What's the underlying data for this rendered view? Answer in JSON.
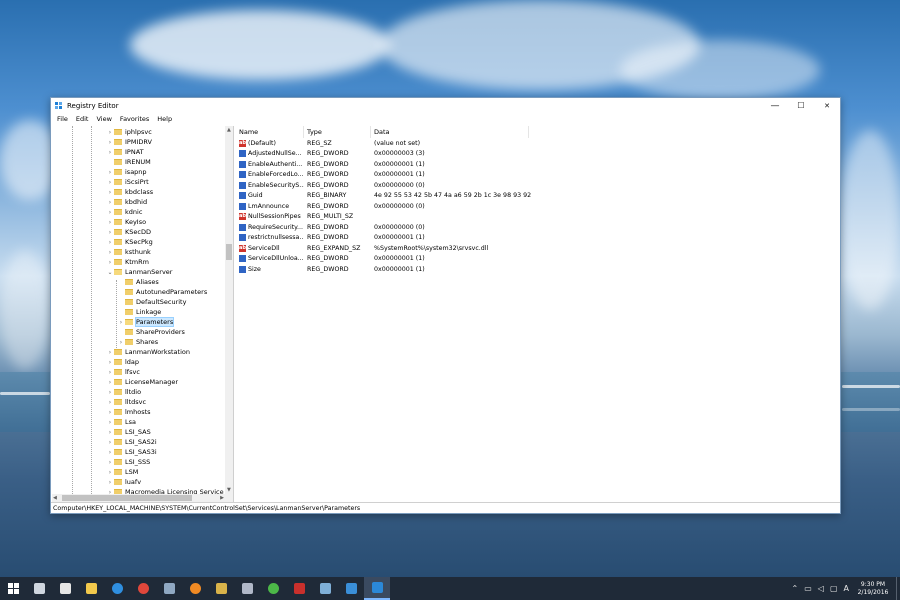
{
  "window": {
    "title": "Registry Editor",
    "minimize": "—",
    "maximize": "☐",
    "close": "✕"
  },
  "menu": [
    "File",
    "Edit",
    "View",
    "Favorites",
    "Help"
  ],
  "tree": [
    {
      "label": "iphlpsvc",
      "depth": 0,
      "expander": "›",
      "open": false,
      "selected": false
    },
    {
      "label": "IPMIDRV",
      "depth": 0,
      "expander": "›",
      "open": false,
      "selected": false
    },
    {
      "label": "IPNAT",
      "depth": 0,
      "expander": "›",
      "open": false,
      "selected": false
    },
    {
      "label": "IRENUM",
      "depth": 0,
      "expander": "",
      "open": false,
      "selected": false
    },
    {
      "label": "isapnp",
      "depth": 0,
      "expander": "›",
      "open": false,
      "selected": false
    },
    {
      "label": "iScsiPrt",
      "depth": 0,
      "expander": "›",
      "open": false,
      "selected": false
    },
    {
      "label": "kbdclass",
      "depth": 0,
      "expander": "›",
      "open": false,
      "selected": false
    },
    {
      "label": "kbdhid",
      "depth": 0,
      "expander": "›",
      "open": false,
      "selected": false
    },
    {
      "label": "kdnic",
      "depth": 0,
      "expander": "›",
      "open": false,
      "selected": false
    },
    {
      "label": "KeyIso",
      "depth": 0,
      "expander": "›",
      "open": false,
      "selected": false
    },
    {
      "label": "KSecDD",
      "depth": 0,
      "expander": "›",
      "open": false,
      "selected": false
    },
    {
      "label": "KSecPkg",
      "depth": 0,
      "expander": "›",
      "open": false,
      "selected": false
    },
    {
      "label": "ksthunk",
      "depth": 0,
      "expander": "›",
      "open": false,
      "selected": false
    },
    {
      "label": "KtmRm",
      "depth": 0,
      "expander": "›",
      "open": false,
      "selected": false
    },
    {
      "label": "LanmanServer",
      "depth": 0,
      "expander": "⌄",
      "open": true,
      "selected": false
    },
    {
      "label": "Aliases",
      "depth": 1,
      "expander": "",
      "open": false,
      "selected": false
    },
    {
      "label": "AutotunedParameters",
      "depth": 1,
      "expander": "",
      "open": false,
      "selected": false
    },
    {
      "label": "DefaultSecurity",
      "depth": 1,
      "expander": "",
      "open": false,
      "selected": false
    },
    {
      "label": "Linkage",
      "depth": 1,
      "expander": "",
      "open": false,
      "selected": false
    },
    {
      "label": "Parameters",
      "depth": 1,
      "expander": "›",
      "open": true,
      "selected": true
    },
    {
      "label": "ShareProviders",
      "depth": 1,
      "expander": "",
      "open": false,
      "selected": false
    },
    {
      "label": "Shares",
      "depth": 1,
      "expander": "›",
      "open": false,
      "selected": false
    },
    {
      "label": "LanmanWorkstation",
      "depth": 0,
      "expander": "›",
      "open": false,
      "selected": false
    },
    {
      "label": "ldap",
      "depth": 0,
      "expander": "›",
      "open": false,
      "selected": false
    },
    {
      "label": "lfsvc",
      "depth": 0,
      "expander": "›",
      "open": false,
      "selected": false
    },
    {
      "label": "LicenseManager",
      "depth": 0,
      "expander": "›",
      "open": false,
      "selected": false
    },
    {
      "label": "lltdio",
      "depth": 0,
      "expander": "›",
      "open": false,
      "selected": false
    },
    {
      "label": "lltdsvc",
      "depth": 0,
      "expander": "›",
      "open": false,
      "selected": false
    },
    {
      "label": "lmhosts",
      "depth": 0,
      "expander": "›",
      "open": false,
      "selected": false
    },
    {
      "label": "Lsa",
      "depth": 0,
      "expander": "›",
      "open": false,
      "selected": false
    },
    {
      "label": "LSI_SAS",
      "depth": 0,
      "expander": "›",
      "open": false,
      "selected": false
    },
    {
      "label": "LSI_SAS2i",
      "depth": 0,
      "expander": "›",
      "open": false,
      "selected": false
    },
    {
      "label": "LSI_SAS3i",
      "depth": 0,
      "expander": "›",
      "open": false,
      "selected": false
    },
    {
      "label": "LSI_SSS",
      "depth": 0,
      "expander": "›",
      "open": false,
      "selected": false
    },
    {
      "label": "LSM",
      "depth": 0,
      "expander": "›",
      "open": false,
      "selected": false
    },
    {
      "label": "luafv",
      "depth": 0,
      "expander": "›",
      "open": false,
      "selected": false
    },
    {
      "label": "Macromedia Licensing Service",
      "depth": 0,
      "expander": "›",
      "open": false,
      "selected": false
    }
  ],
  "columns": {
    "name": "Name",
    "type": "Type",
    "data": "Data"
  },
  "values": [
    {
      "name": "(Default)",
      "type": "REG_SZ",
      "data": "(value not set)",
      "icon": "string-value-icon",
      "glyph": "ab"
    },
    {
      "name": "AdjustedNullSe...",
      "type": "REG_DWORD",
      "data": "0x00000003 (3)",
      "icon": "binary-value-icon",
      "glyph": ""
    },
    {
      "name": "EnableAuthenti...",
      "type": "REG_DWORD",
      "data": "0x00000001 (1)",
      "icon": "binary-value-icon",
      "glyph": ""
    },
    {
      "name": "EnableForcedLo...",
      "type": "REG_DWORD",
      "data": "0x00000001 (1)",
      "icon": "binary-value-icon",
      "glyph": ""
    },
    {
      "name": "EnableSecurityS...",
      "type": "REG_DWORD",
      "data": "0x00000000 (0)",
      "icon": "binary-value-icon",
      "glyph": ""
    },
    {
      "name": "Guid",
      "type": "REG_BINARY",
      "data": "4e 92 55 53 42 5b 47 4a a6 59 2b 1c 3e 98 93 92",
      "icon": "binary-value-icon",
      "glyph": ""
    },
    {
      "name": "LmAnnounce",
      "type": "REG_DWORD",
      "data": "0x00000000 (0)",
      "icon": "binary-value-icon",
      "glyph": ""
    },
    {
      "name": "NullSessionPipes",
      "type": "REG_MULTI_SZ",
      "data": "",
      "icon": "string-value-icon",
      "glyph": "ab"
    },
    {
      "name": "RequireSecurity...",
      "type": "REG_DWORD",
      "data": "0x00000000 (0)",
      "icon": "binary-value-icon",
      "glyph": ""
    },
    {
      "name": "restrictnullsessa...",
      "type": "REG_DWORD",
      "data": "0x00000001 (1)",
      "icon": "binary-value-icon",
      "glyph": ""
    },
    {
      "name": "ServiceDll",
      "type": "REG_EXPAND_SZ",
      "data": "%SystemRoot%\\system32\\srvsvc.dll",
      "icon": "string-value-icon",
      "glyph": "ab"
    },
    {
      "name": "ServiceDllUnloa...",
      "type": "REG_DWORD",
      "data": "0x00000001 (1)",
      "icon": "binary-value-icon",
      "glyph": ""
    },
    {
      "name": "Size",
      "type": "REG_DWORD",
      "data": "0x00000001 (1)",
      "icon": "binary-value-icon",
      "glyph": ""
    }
  ],
  "status_path": "Computer\\HKEY_LOCAL_MACHINE\\SYSTEM\\CurrentControlSet\\Services\\LanmanServer\\Parameters",
  "taskbar": {
    "icons": [
      {
        "name": "task-view-icon",
        "color": "#cfd6df"
      },
      {
        "name": "store-icon",
        "color": "#e6e6e6"
      },
      {
        "name": "file-explorer-icon",
        "color": "#f2c94c"
      },
      {
        "name": "edge-icon",
        "color": "#2f8fe0"
      },
      {
        "name": "chrome-icon",
        "color": "#e0473b"
      },
      {
        "name": "photos-icon",
        "color": "#8fa8c2"
      },
      {
        "name": "orange-app-icon",
        "color": "#f08a24"
      },
      {
        "name": "pen-app-icon",
        "color": "#d9b34a"
      },
      {
        "name": "calibre-icon",
        "color": "#b0b8c8"
      },
      {
        "name": "greenshot-icon",
        "color": "#4cb848"
      },
      {
        "name": "filezilla-icon",
        "color": "#c9302c"
      },
      {
        "name": "notepad-icon",
        "color": "#7fb0d8"
      },
      {
        "name": "remote-app-icon",
        "color": "#3a8fd8"
      },
      {
        "name": "registry-editor-taskbar-icon",
        "color": "#2b88d8"
      }
    ],
    "tray": {
      "ime": "A",
      "time": "9:30 PM",
      "date": "2/19/2016"
    }
  }
}
